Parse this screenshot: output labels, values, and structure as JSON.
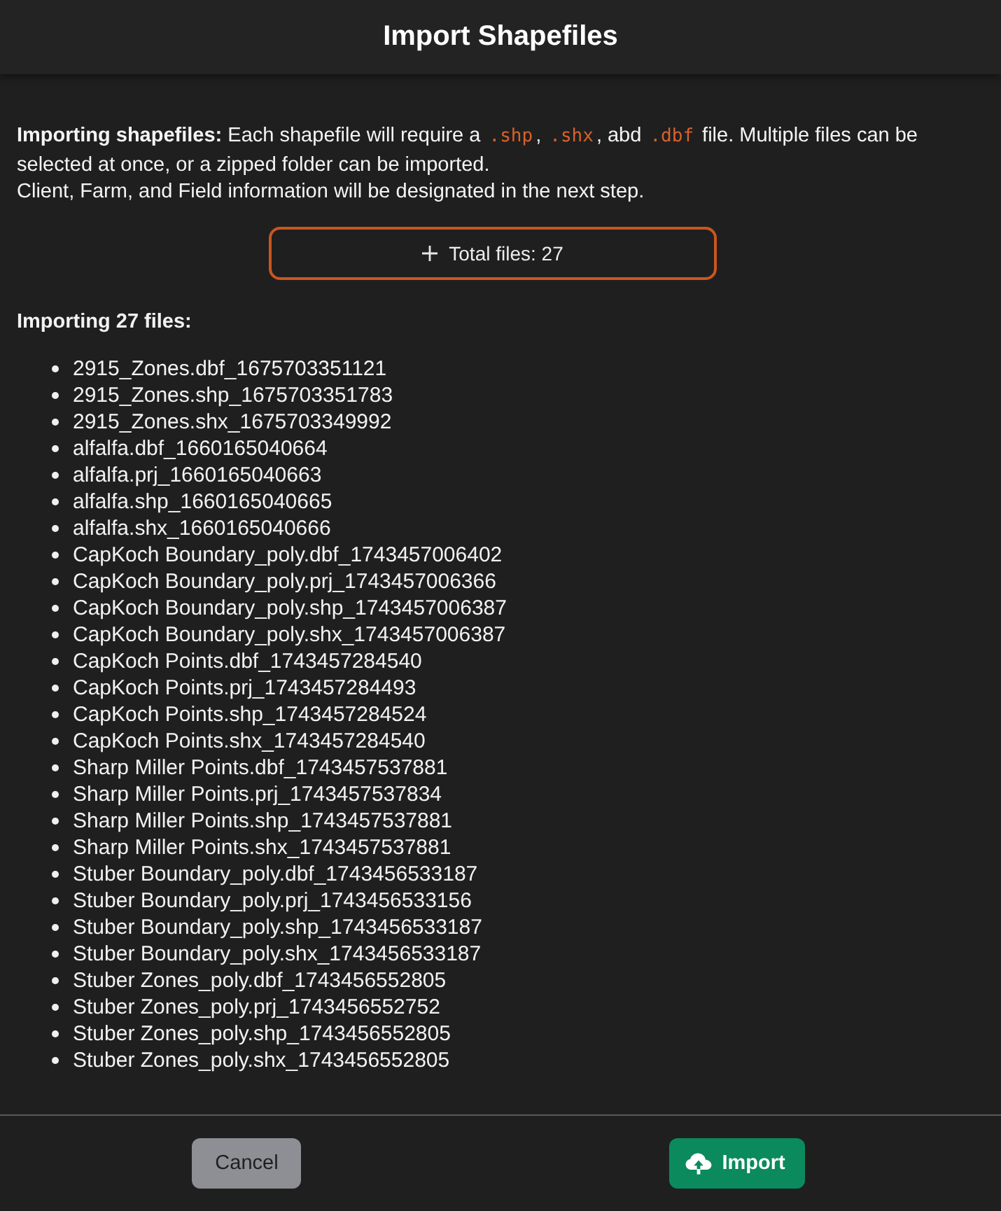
{
  "dialog": {
    "title": "Import Shapefiles"
  },
  "intro": {
    "segments": [
      {
        "kind": "text",
        "text": "**Importing shapefiles:** Each shapefile will require a "
      },
      {
        "kind": "code",
        "text": ".shp"
      },
      {
        "kind": "text",
        "text": ", "
      },
      {
        "kind": "code",
        "text": ".shx"
      },
      {
        "kind": "text",
        "text": ", abd "
      },
      {
        "kind": "code",
        "text": ".dbf"
      },
      {
        "kind": "text",
        "text": " file. Multiple files can be selected at once, or a zipped folder can be imported."
      }
    ],
    "note": "Client, Farm, and Field information will be designated in the next step."
  },
  "total_files_button": {
    "label": "Total files: 27"
  },
  "files": {
    "heading": "Importing 27 files:",
    "items": [
      "2915_Zones.dbf_1675703351121",
      "2915_Zones.shp_1675703351783",
      "2915_Zones.shx_1675703349992",
      "alfalfa.dbf_1660165040664",
      "alfalfa.prj_1660165040663",
      "alfalfa.shp_1660165040665",
      "alfalfa.shx_1660165040666",
      "CapKoch Boundary_poly.dbf_1743457006402",
      "CapKoch Boundary_poly.prj_1743457006366",
      "CapKoch Boundary_poly.shp_1743457006387",
      "CapKoch Boundary_poly.shx_1743457006387",
      "CapKoch Points.dbf_1743457284540",
      "CapKoch Points.prj_1743457284493",
      "CapKoch Points.shp_1743457284524",
      "CapKoch Points.shx_1743457284540",
      "Sharp Miller Points.dbf_1743457537881",
      "Sharp Miller Points.prj_1743457537834",
      "Sharp Miller Points.shp_1743457537881",
      "Sharp Miller Points.shx_1743457537881",
      "Stuber Boundary_poly.dbf_1743456533187",
      "Stuber Boundary_poly.prj_1743456533156",
      "Stuber Boundary_poly.shp_1743456533187",
      "Stuber Boundary_poly.shx_1743456533187",
      "Stuber Zones_poly.dbf_1743456552805",
      "Stuber Zones_poly.prj_1743456552752",
      "Stuber Zones_poly.shp_1743456552805",
      "Stuber Zones_poly.shx_1743456552805"
    ]
  },
  "buttons": [
    {
      "label": "Cancel",
      "kind": "secondary"
    },
    {
      "label": "Import",
      "kind": "primary"
    }
  ]
}
